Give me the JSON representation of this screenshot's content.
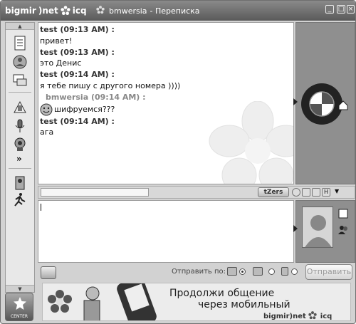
{
  "titlebar": {
    "brand_left": "bigmir",
    "brand_mid": ")net",
    "brand_icq": "icq",
    "contact": "bmwersia",
    "title_suffix": " - Переписка",
    "close_glyph": "×"
  },
  "messages": [
    {
      "header": "test (09:13 AM) :",
      "text": "привет!",
      "me": false
    },
    {
      "header": "test (09:13 AM) :",
      "text": "это Денис",
      "me": false
    },
    {
      "header": "test (09:14 AM) :",
      "text": "я тебе пишу с другого номера ))))",
      "me": false
    },
    {
      "header": "bmwersia (09:14 AM) :",
      "text": "шифруемся???",
      "me": true
    },
    {
      "header": "test (09:14 AM) :",
      "text": "ага",
      "me": false
    }
  ],
  "toolbar": {
    "tzers_label": "tZers"
  },
  "bottom": {
    "send_by_label": "Отправить по:",
    "send_button": "Отправить"
  },
  "center_button": "CENTER",
  "banner": {
    "line1": "Продолжи общение",
    "line2": "через мобильный",
    "logo": "bigmir)net",
    "logo_icq": "icq"
  },
  "colors": {
    "titlebar": "#6e6e6e",
    "panel": "#8f8f8f"
  }
}
